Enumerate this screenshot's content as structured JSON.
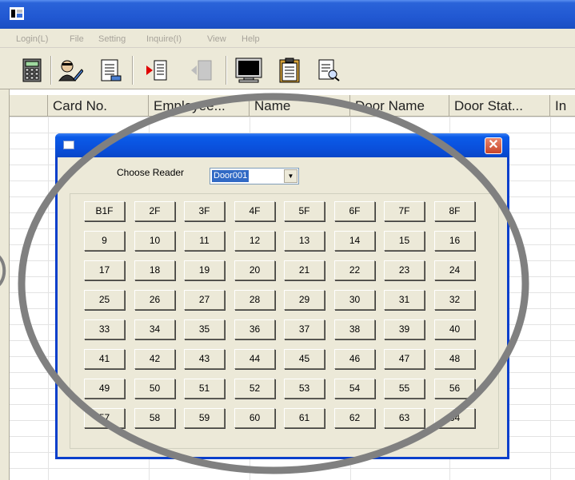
{
  "menu": {
    "items": [
      "Login(L)",
      "File",
      "Setting",
      "Inquire(I)",
      "View",
      "Help"
    ]
  },
  "toolbar": {
    "icons": [
      "calculator-icon",
      "user-edit-icon",
      "document-icon",
      "door-in-icon",
      "door-out-icon",
      "monitor-icon",
      "clipboard-icon",
      "report-search-icon"
    ]
  },
  "grid": {
    "columns": [
      "Card No.",
      "Employee...",
      "Name",
      "Door Name",
      "Door Stat...",
      "In"
    ]
  },
  "dialog": {
    "reader_label": "Choose Reader",
    "reader_value": "Door001",
    "close_symbol": "✕",
    "floors": [
      "B1F",
      "2F",
      "3F",
      "4F",
      "5F",
      "6F",
      "7F",
      "8F",
      "9",
      "10",
      "11",
      "12",
      "13",
      "14",
      "15",
      "16",
      "17",
      "18",
      "19",
      "20",
      "21",
      "22",
      "23",
      "24",
      "25",
      "26",
      "27",
      "28",
      "29",
      "30",
      "31",
      "32",
      "33",
      "34",
      "35",
      "36",
      "37",
      "38",
      "39",
      "40",
      "41",
      "42",
      "43",
      "44",
      "45",
      "46",
      "47",
      "48",
      "49",
      "50",
      "51",
      "52",
      "53",
      "54",
      "55",
      "56",
      "57",
      "58",
      "59",
      "60",
      "61",
      "62",
      "63",
      "64"
    ]
  },
  "colors": {
    "title_blue": "#2158d2",
    "dialog_face": "#ece9d8",
    "annotation_gray": "#808080"
  }
}
